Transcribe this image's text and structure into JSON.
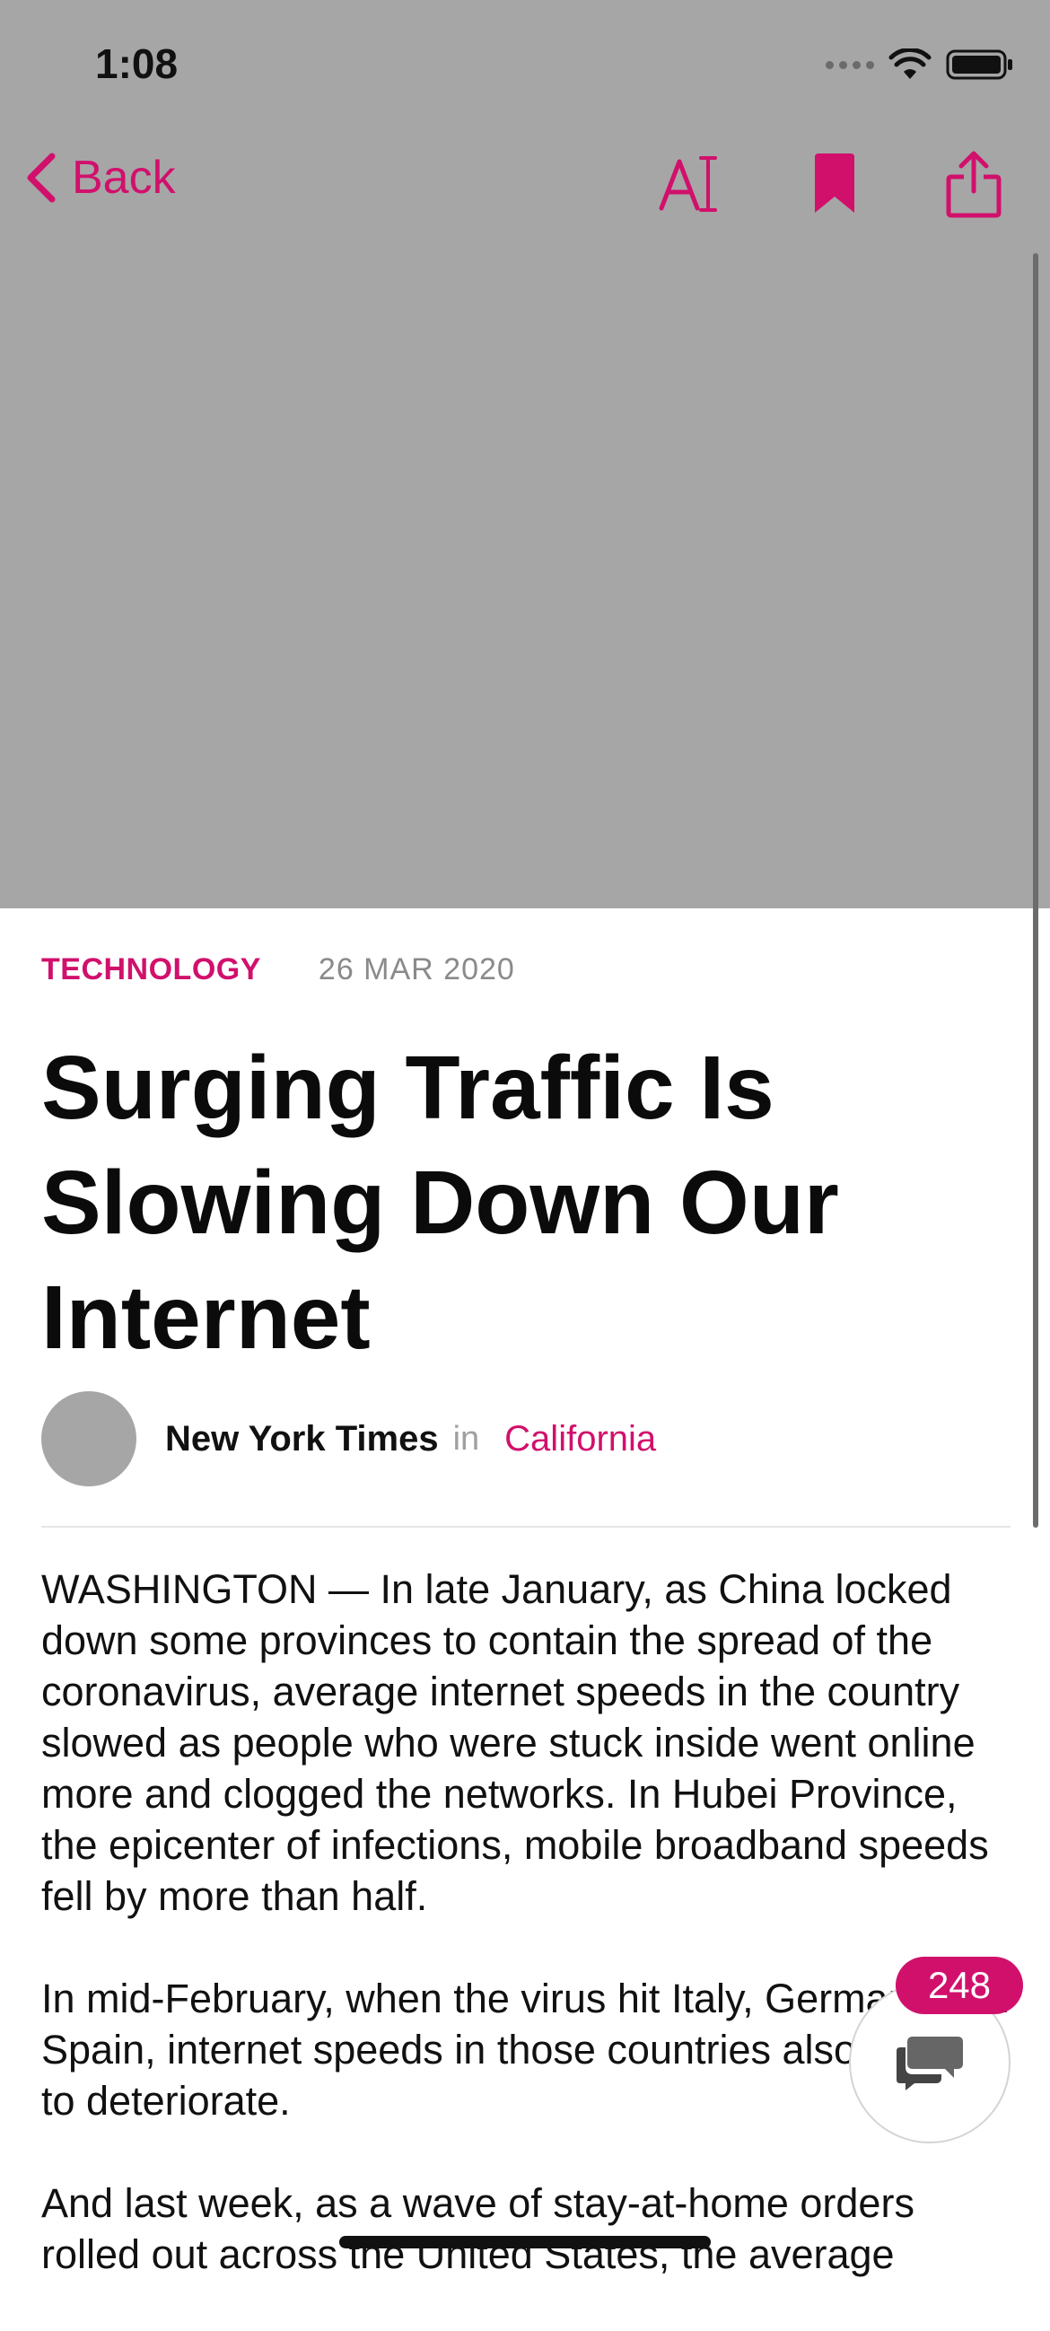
{
  "status_bar": {
    "time": "1:08"
  },
  "nav": {
    "back_label": "Back"
  },
  "article": {
    "category": "TECHNOLOGY",
    "date": "26 MAR 2020",
    "title": "Surging Traffic Is Slowing Down Our Internet",
    "author": "New York Times",
    "in_label": "in",
    "location": "California",
    "paragraphs": [
      "WASHINGTON — In late January, as China locked down some provinces to contain the spread of the coronavirus, average internet speeds in the country slowed as people who were stuck inside went online more and clogged the networks. In Hubei Province, the epicenter of infections, mobile broadband speeds fell by more than half.",
      "In mid-February, when the virus hit Italy, Germany and Spain, internet speeds in those countries also began to deteriorate.",
      "And last week, as a wave of stay-at-home orders rolled out across the United States, the average"
    ]
  },
  "comments": {
    "count": "248"
  },
  "colors": {
    "accent": "#d1106c",
    "hero_placeholder": "#a6a6a6"
  }
}
